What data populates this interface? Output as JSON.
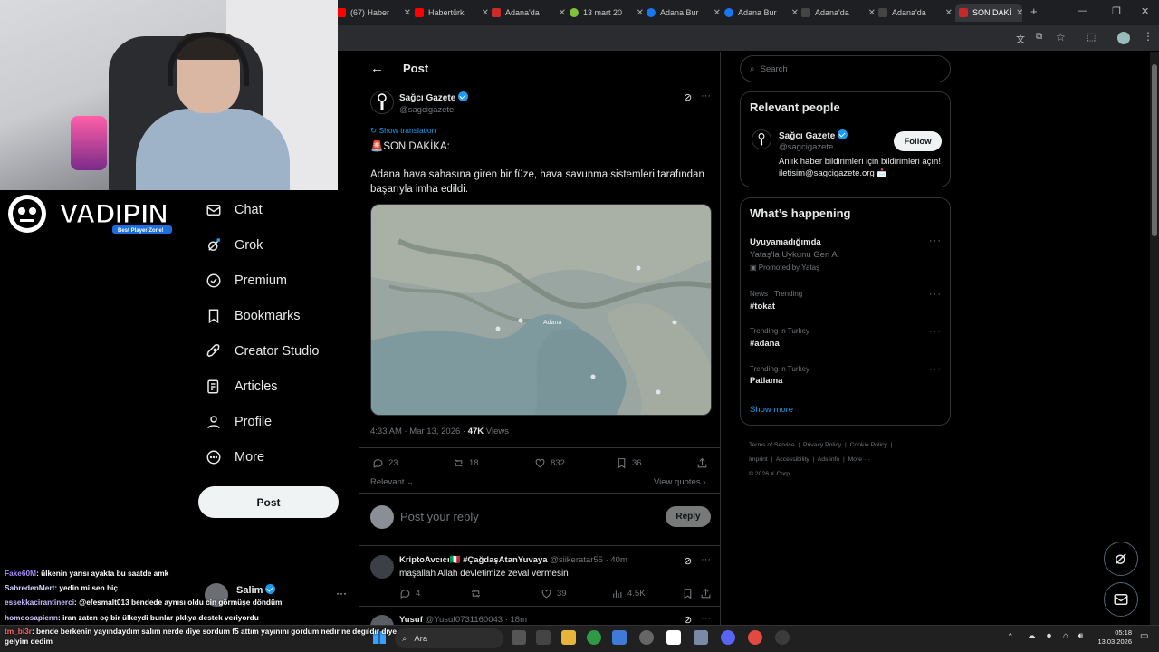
{
  "browser": {
    "tabs": [
      {
        "label": "(67) Haber",
        "color": "#ff0000"
      },
      {
        "label": "Habertürk",
        "color": "#ff0000"
      },
      {
        "label": "Adana'da",
        "color": "#cc2b2b"
      },
      {
        "label": "13 mart 20",
        "color": "#81c23b"
      },
      {
        "label": "Adana Bur",
        "color": "#1877f2"
      },
      {
        "label": "Adana Bur",
        "color": "#1877f2"
      },
      {
        "label": "Adana'da",
        "color": "#444444"
      },
      {
        "label": "Adana'da",
        "color": "#444444"
      },
      {
        "label": "SON DAKİ",
        "color": "#c62828"
      }
    ],
    "new_tab": "+"
  },
  "overlay": {
    "brand": "VADIPIN",
    "brand_tagline": "Best Player Zone!"
  },
  "nav": {
    "items": [
      {
        "label": "Chat",
        "icon": "mail-icon"
      },
      {
        "label": "Grok",
        "icon": "grok-icon"
      },
      {
        "label": "Premium",
        "icon": "verified-icon"
      },
      {
        "label": "Bookmarks",
        "icon": "bookmark-icon"
      },
      {
        "label": "Creator Studio",
        "icon": "rocket-icon"
      },
      {
        "label": "Articles",
        "icon": "articles-icon"
      },
      {
        "label": "Profile",
        "icon": "profile-icon"
      },
      {
        "label": "More",
        "icon": "more-icon"
      }
    ],
    "post_button": "Post",
    "account_name": "Salim"
  },
  "post": {
    "header": "Post",
    "author_name": "Sağcı Gazete",
    "author_handle": "@sagcigazete",
    "show_translation": "Show translation",
    "text_line1": "🚨SON DAKİKA:",
    "text_line2": "Adana hava sahasına giren bir füze, hava savunma sistemleri tarafından başarıyla imha edildi.",
    "map_label": "Adana",
    "time": "4:33 AM · Mar 13, 2026 · ",
    "views_count": "47K",
    "views_label": " Views",
    "stats": {
      "replies": "23",
      "reposts": "18",
      "likes": "832",
      "bookmarks": "36"
    },
    "relevant": "Relevant",
    "view_quotes": "View quotes",
    "reply_placeholder": "Post your reply",
    "reply_button": "Reply"
  },
  "replies": [
    {
      "name": "KriptoAvcıcı🇮🇹 #ÇağdaşAtanYuvaya",
      "handle": "@siikeratar55 · 40m",
      "text": "maşallah Allah devletimize zeval vermesin",
      "replies": "4",
      "likes": "39",
      "views": "4.5K"
    },
    {
      "name": "Yusuf",
      "handle": "@Yusuf0731160043 · 18m"
    }
  ],
  "sidebar": {
    "search_placeholder": "Search",
    "relevant_title": "Relevant people",
    "person_name": "Sağcı Gazete",
    "person_handle": "@sagcigazete",
    "person_bio": "Anlık haber bildirimleri için bildirimleri açın! iletisim@sagcigazete.org 📩",
    "follow": "Follow",
    "happening_title": "What’s happening",
    "trends": [
      {
        "meta": "",
        "title": "Uyuyamadığımda",
        "sub": "Yataş'la Uykunu Geri Al",
        "promo": "Promoted by Yataş"
      },
      {
        "meta": "News · Trending",
        "title": "#tokat"
      },
      {
        "meta": "Trending in Turkey",
        "title": "#adana"
      },
      {
        "meta": "Trending in Turkey",
        "title": "Patlama"
      }
    ],
    "show_more": "Show more",
    "footer": [
      "Terms of Service",
      "Privacy Policy",
      "Cookie Policy",
      "Imprint",
      "Accessibility",
      "Ads info",
      "More ···",
      "© 2026 X Corp."
    ]
  },
  "chat": [
    {
      "user": "Fake60M",
      "color": "#a78bfa",
      "msg": ": ülkenin yarısı ayakta bu saatde amk"
    },
    {
      "user": "SabredenMert",
      "color": "#cfd8ff",
      "msg": ": yedin mi sen hiç"
    },
    {
      "user": "essekkacirantinerci",
      "color": "#c6b7ff",
      "msg": ": @efesmalt013 bendede aynısı oldu cin görmüşe döndüm"
    },
    {
      "user": "homoosapienn",
      "color": "#d7c8ff",
      "msg": ": iran zaten oç bir ülkeydi bunlar pkkya destek veriyordu"
    },
    {
      "user": "tm_bi3r",
      "color": "#ff6b6b",
      "msg": ": bende berkenin yayındaydım salım nerde diye sordum f5 attım yayınını gordum nedır ne degıldır dıye gelyim dedim"
    }
  ],
  "taskbar": {
    "search": "Ara",
    "time": "05:18",
    "date": "13.03.2026"
  }
}
